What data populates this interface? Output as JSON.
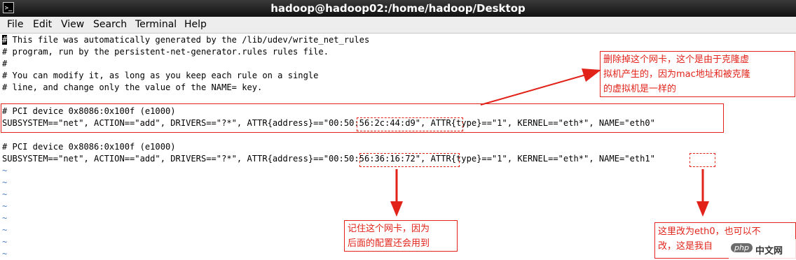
{
  "window": {
    "title": "hadoop@hadoop02:/home/hadoop/Desktop",
    "icon": "terminal-icon"
  },
  "menu": {
    "items": [
      "File",
      "Edit",
      "View",
      "Search",
      "Terminal",
      "Help"
    ]
  },
  "terminal": {
    "lines": [
      " This file was automatically generated by the /lib/udev/write_net_rules",
      "# program, run by the persistent-net-generator.rules rules file.",
      "#",
      "# You can modify it, as long as you keep each rule on a single",
      "# line, and change only the value of the NAME= key.",
      "",
      "# PCI device 0x8086:0x100f (e1000)",
      "SUBSYSTEM==\"net\", ACTION==\"add\", DRIVERS==\"?*\", ATTR{address}==\"00:50:56:2c:44:d9\", ATTR{type}==\"1\", KERNEL==\"eth*\", NAME=\"eth0\"",
      "",
      "# PCI device 0x8086:0x100f (e1000)",
      "SUBSYSTEM==\"net\", ACTION==\"add\", DRIVERS==\"?*\", ATTR{address}==\"00:50:56:36:16:72\", ATTR{type}==\"1\", KERNEL==\"eth*\", NAME=\"eth1\""
    ],
    "cursor_char": "#",
    "empty_line_marker": "~"
  },
  "annotations": {
    "delete_note": "删除掉这个网卡，这个是由于克隆虚\n拟机产生的，因为mac地址和被克隆\n的虚拟机是一样的",
    "remember_note": "记住这个网卡，因为\n后面的配置还会用到",
    "rename_note": "这里改为eth0，也可以不\n改，这是我自"
  },
  "watermark": {
    "badge": "php",
    "site": "中文网"
  },
  "colors": {
    "annotation_red": "#e2231a",
    "tilde_blue": "#4a7fc0",
    "titlebar": "#1e1e1e",
    "menubar": "#ededed"
  }
}
